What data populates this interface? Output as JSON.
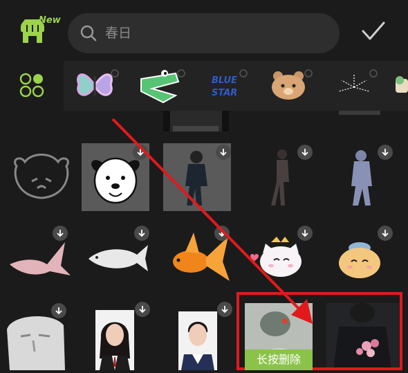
{
  "header": {
    "store_badge": "New",
    "search_placeholder": "春日",
    "confirm_icon": "check-icon"
  },
  "categories": [
    {
      "icon": "all-grid-icon",
      "selected": true
    },
    {
      "icon": "butterfly-sticker-icon"
    },
    {
      "icon": "crocodile-sticker-icon"
    },
    {
      "icon": "blue-star-sticker-icon",
      "text": "BLUE STAR"
    },
    {
      "icon": "bear-sticker-icon"
    },
    {
      "icon": "fireworks-sticker-icon"
    },
    {
      "icon": "cup-sticker-icon"
    }
  ],
  "grid": {
    "rows": [
      [
        "dog-outline",
        "dog-drawing",
        "walking-man",
        "woman-walking",
        "person-walking-back"
      ],
      [
        "koi-fish",
        "white-fish",
        "goldfish",
        "white-cat-crown",
        "orange-cat-hat"
      ],
      [
        "sculpture-face",
        "girl-portrait",
        "boy-portrait",
        "photo-cat-blanket",
        "photo-man-flowers"
      ]
    ]
  },
  "overlay": {
    "long_press_label": "长按删除",
    "highlight_color": "#e2191c",
    "accent_color": "#8bc34a"
  }
}
